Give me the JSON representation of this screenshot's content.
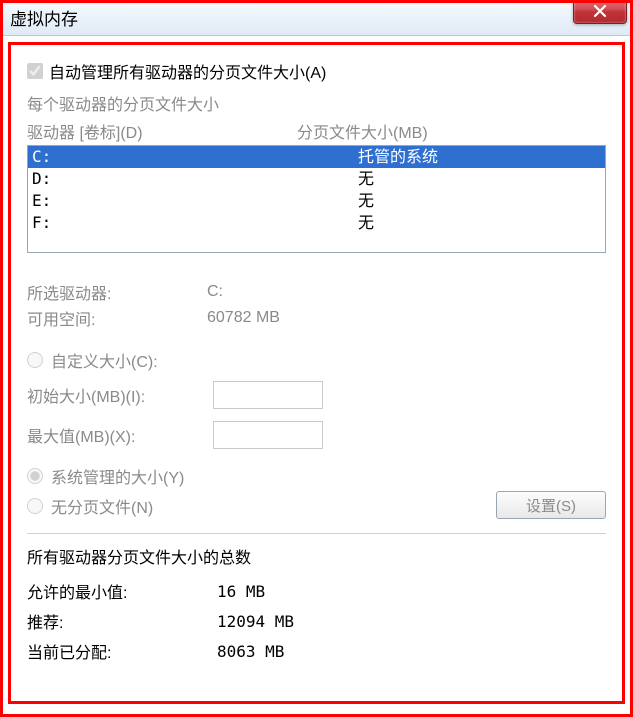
{
  "window": {
    "title": "虚拟内存"
  },
  "auto_manage": {
    "checked": true,
    "label": "自动管理所有驱动器的分页文件大小(A)"
  },
  "per_drive_section": "每个驱动器的分页文件大小",
  "columns": {
    "drive": "驱动器 [卷标](D)",
    "size": "分页文件大小(MB)"
  },
  "drives": [
    {
      "letter": "C:",
      "status": "托管的系统",
      "selected": true
    },
    {
      "letter": "D:",
      "status": "无",
      "selected": false
    },
    {
      "letter": "E:",
      "status": "无",
      "selected": false
    },
    {
      "letter": "F:",
      "status": "无",
      "selected": false
    }
  ],
  "selected_info": {
    "drive_label": "所选驱动器:",
    "drive_value": "C:",
    "space_label": "可用空间:",
    "space_value": "60782 MB"
  },
  "size_option": {
    "custom_label": "自定义大小(C):",
    "initial_label": "初始大小(MB)(I):",
    "initial_value": "",
    "max_label": "最大值(MB)(X):",
    "max_value": "",
    "system_label": "系统管理的大小(Y)",
    "none_label": "无分页文件(N)",
    "selected": "system"
  },
  "set_button": "设置(S)",
  "totals": {
    "section": "所有驱动器分页文件大小的总数",
    "min_label": "允许的最小值:",
    "min_value": "16 MB",
    "rec_label": "推荐:",
    "rec_value": "12094 MB",
    "cur_label": "当前已分配:",
    "cur_value": "8063 MB"
  }
}
